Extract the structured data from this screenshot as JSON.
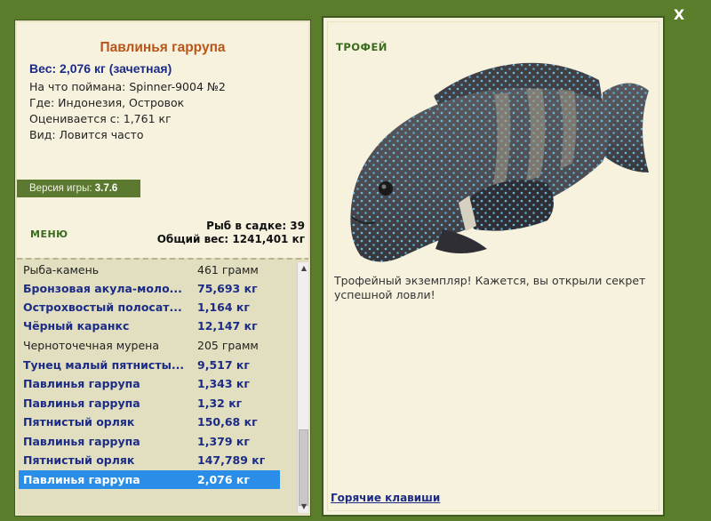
{
  "window": {
    "close_label": "X"
  },
  "catch_info": {
    "title": "Павлинья гаррупа",
    "weight": "Вес: 2,076 кг (зачетная)",
    "caught_with": "На что поймана: Spinner-9004 №2",
    "location": "Где: Индонезия, Островок",
    "valued_from": "Оценивается с: 1,761 кг",
    "kind": "Вид: Ловится часто"
  },
  "version": {
    "label": "Версия игры:",
    "number": "3.7.6"
  },
  "menu": {
    "label": "МЕНЮ"
  },
  "keepnet": {
    "count": "Рыб в садке: 39",
    "total_weight": "Общий вес: 1241,401 кг"
  },
  "catch_list": [
    {
      "name": "Рыба-камень",
      "weight": "461 грамм",
      "trophy": false,
      "selected": false
    },
    {
      "name": "Бронзовая акула-моло...",
      "weight": "75,693 кг",
      "trophy": true,
      "selected": false
    },
    {
      "name": "Острохвостый полосат...",
      "weight": "1,164 кг",
      "trophy": true,
      "selected": false
    },
    {
      "name": "Чёрный каранкс",
      "weight": "12,147 кг",
      "trophy": true,
      "selected": false
    },
    {
      "name": "Черноточечная мурена",
      "weight": "205 грамм",
      "trophy": false,
      "selected": false
    },
    {
      "name": "Тунец малый пятнисты...",
      "weight": "9,517 кг",
      "trophy": true,
      "selected": false
    },
    {
      "name": "Павлинья гаррупа",
      "weight": "1,343 кг",
      "trophy": true,
      "selected": false
    },
    {
      "name": "Павлинья гаррупа",
      "weight": "1,32 кг",
      "trophy": true,
      "selected": false
    },
    {
      "name": "Пятнистый орляк",
      "weight": "150,68 кг",
      "trophy": true,
      "selected": false
    },
    {
      "name": "Павлинья гаррупа",
      "weight": "1,379 кг",
      "trophy": true,
      "selected": false
    },
    {
      "name": "Пятнистый орляк",
      "weight": "147,789 кг",
      "trophy": true,
      "selected": false
    },
    {
      "name": "Павлинья гаррупа",
      "weight": "2,076 кг",
      "trophy": true,
      "selected": true
    }
  ],
  "trophy_panel": {
    "label": "ТРОФЕЙ",
    "description": "Трофейный экземпляр! Кажется, вы открыли секрет успешной ловли!",
    "hotkeys_label": "Горячие клавиши"
  },
  "colors": {
    "frame_green": "#5a7d2c",
    "panel_bg": "#f6f2de",
    "title_orange": "#b8561a",
    "trophy_blue": "#1c2c86",
    "selection_blue": "#2a8ee8",
    "menu_green": "#3a6b1c"
  },
  "icons": {
    "close": "close-icon",
    "scroll_up": "scroll-up-arrow-icon",
    "scroll_down": "scroll-down-arrow-icon"
  }
}
